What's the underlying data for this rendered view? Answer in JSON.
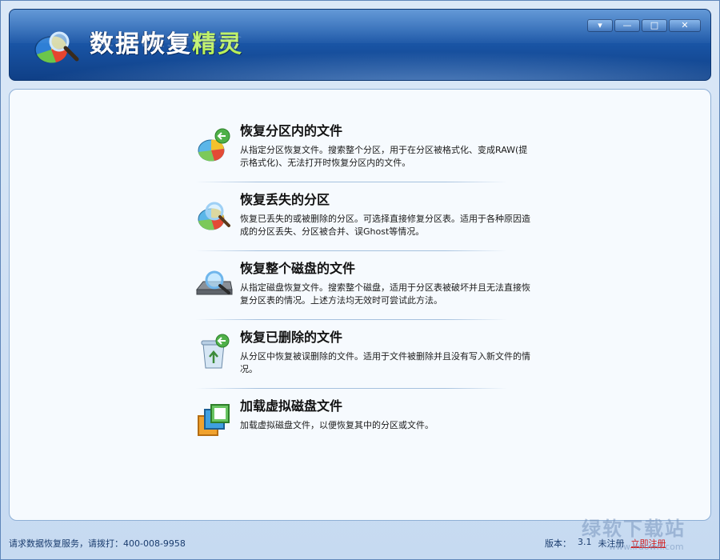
{
  "app": {
    "title_main": "数据恢复",
    "title_accent": "精灵"
  },
  "window_buttons": [
    "▾",
    "—",
    "□",
    "✕"
  ],
  "menu": [
    {
      "heading": "恢复分区内的文件",
      "desc": "从指定分区恢复文件。搜索整个分区，用于在分区被格式化、变成RAW(提示格式化)、无法打开时恢复分区内的文件。",
      "icon": "partition-recover-icon"
    },
    {
      "heading": "恢复丢失的分区",
      "desc": "恢复已丢失的或被删除的分区。可选择直接修复分区表。适用于各种原因造成的分区丢失、分区被合并、误Ghost等情况。",
      "icon": "search-partition-icon"
    },
    {
      "heading": "恢复整个磁盘的文件",
      "desc": "从指定磁盘恢复文件。搜索整个磁盘，适用于分区表被破坏并且无法直接恢复分区表的情况。上述方法均无效时可尝试此方法。",
      "icon": "disk-search-icon"
    },
    {
      "heading": "恢复已删除的文件",
      "desc": "从分区中恢复被误删除的文件。适用于文件被删除并且没有写入新文件的情况。",
      "icon": "recycle-bin-icon"
    },
    {
      "heading": "加载虚拟磁盘文件",
      "desc": "加载虚拟磁盘文件，以便恢复其中的分区或文件。",
      "icon": "virtual-disk-icon"
    }
  ],
  "status": {
    "service": "请求数据恢复服务，请拨打：400-008-9958",
    "version_label": "版本：",
    "version_value": "3.1",
    "unregistered": "未注册",
    "register": "立即注册"
  },
  "watermark": {
    "text": "绿软下载站",
    "sub": "www.lrdown.com"
  }
}
